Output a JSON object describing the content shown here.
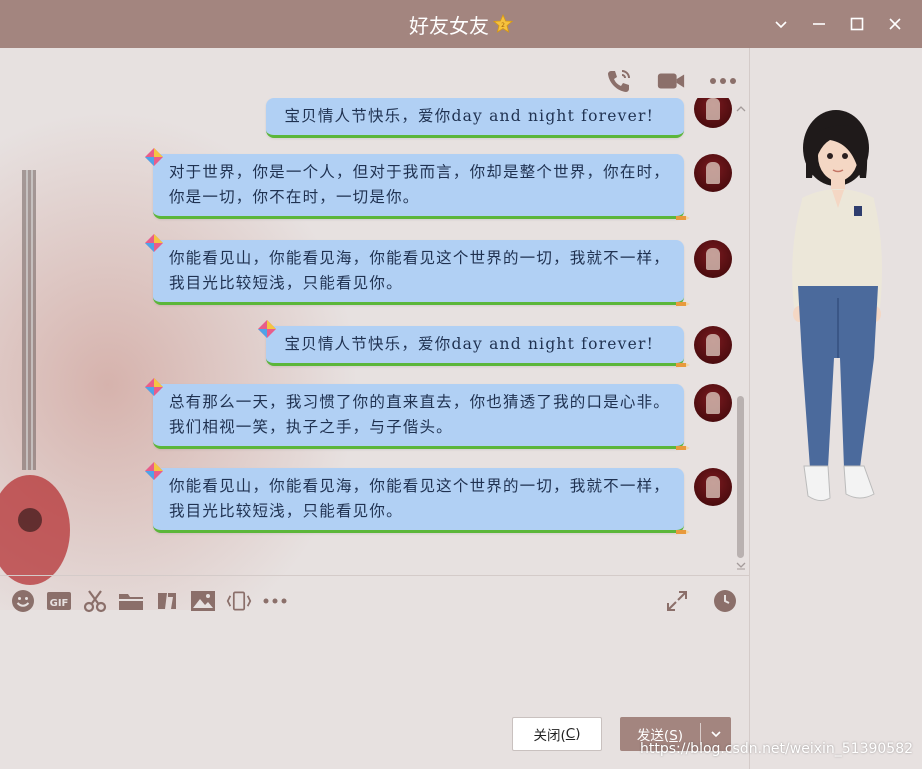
{
  "window": {
    "title": "好友女友",
    "controls": [
      "chevron-down-icon",
      "minimize-icon",
      "maximize-icon",
      "close-icon"
    ]
  },
  "header_actions": [
    "phone-icon",
    "video-icon",
    "more-icon"
  ],
  "messages": [
    {
      "text_lines": [
        "宝贝情人节快乐，爱你day and night forever!"
      ]
    },
    {
      "text_lines": [
        "对于世界，你是一个人，但对于我而言，你却是整个世界，你在时，",
        "你是一切，你不在时，一切是你。"
      ]
    },
    {
      "text_lines": [
        "你能看见山，你能看见海，你能看见这个世界的一切，我就不一样，",
        "我目光比较短浅，只能看见你。"
      ]
    },
    {
      "text_lines": [
        "宝贝情人节快乐，爱你day and night forever!"
      ]
    },
    {
      "text_lines": [
        "总有那么一天，我习惯了你的直来直去，你也猜透了我的口是心非。",
        "我们相视一笑，执子之手，与子偕头。"
      ]
    },
    {
      "text_lines": [
        "你能看见山，你能看见海，你能看见这个世界的一切，我就不一样，",
        "我目光比较短浅，只能看见你。"
      ]
    }
  ],
  "toolbar": {
    "left": [
      "emoji-icon",
      "gif-icon",
      "scissors-icon",
      "folder-icon",
      "shake-icon",
      "image-icon",
      "screen-share-icon",
      "more-icon"
    ],
    "right": [
      "expand-icon",
      "history-icon"
    ]
  },
  "buttons": {
    "close_label": "关闭(",
    "close_key": "C",
    "close_end": ")",
    "send_label": "发送(",
    "send_key": "S",
    "send_end": ")"
  },
  "watermark": "https://blog.csdn.net/weixin_51390582",
  "colors": {
    "titlebar": "#a3857f",
    "bubble": "#b1d0f4",
    "bubble_border": "#5cb63a",
    "background": "#e7e1e0"
  }
}
